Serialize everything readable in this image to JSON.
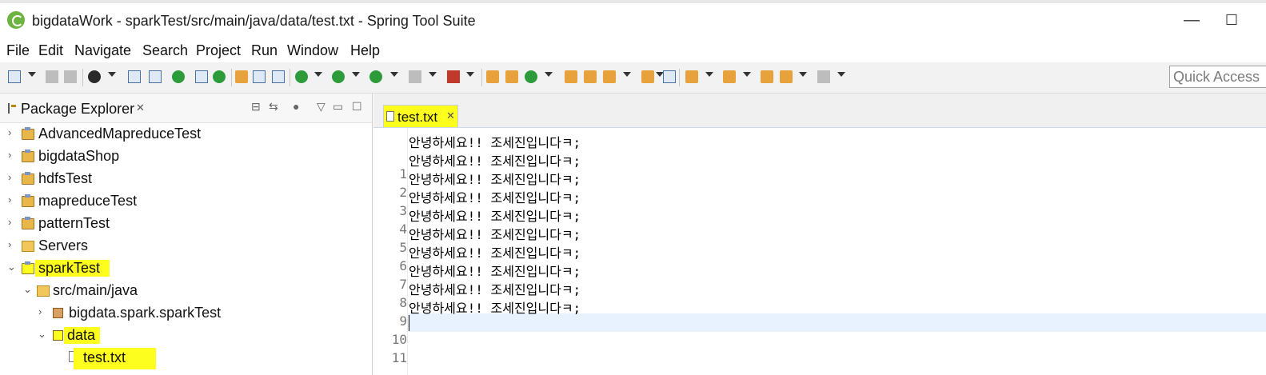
{
  "window": {
    "title": "bigdataWork - sparkTest/src/main/java/data/test.txt - Spring Tool Suite",
    "min_glyph": "—",
    "max_glyph": "☐"
  },
  "menu": [
    "File",
    "Edit",
    "Navigate",
    "Search",
    "Project",
    "Run",
    "Window",
    "Help"
  ],
  "toolbar": {
    "quick_access_placeholder": "Quick Access",
    "icons": [
      "new-icon",
      "save-icon",
      "save-all-icon",
      "debug-icon",
      "run-icon",
      "external-tools-icon",
      "stop-icon",
      "search-icon",
      "back-icon",
      "forward-icon"
    ]
  },
  "explorer": {
    "tab_label": "Package Explorer",
    "close_glyph": "✕",
    "tree": [
      {
        "label": "AdvancedMapreduceTest",
        "icon": "project",
        "expanded": false
      },
      {
        "label": "bigdataShop",
        "icon": "project",
        "expanded": false
      },
      {
        "label": "hdfsTest",
        "icon": "project",
        "expanded": false
      },
      {
        "label": "mapreduceTest",
        "icon": "project",
        "expanded": false
      },
      {
        "label": "patternTest",
        "icon": "project",
        "expanded": false
      },
      {
        "label": "Servers",
        "icon": "folder",
        "expanded": false
      },
      {
        "label": "sparkTest",
        "icon": "project",
        "expanded": true,
        "highlighted": true
      },
      {
        "label": "src/main/java",
        "icon": "source-folder",
        "expanded": true
      },
      {
        "label": "bigdata.spark.sparkTest",
        "icon": "package",
        "expanded": false
      },
      {
        "label": "data",
        "icon": "package",
        "expanded": true,
        "highlighted": true
      },
      {
        "label": "test.txt",
        "icon": "file",
        "selected": true,
        "highlighted": true
      }
    ]
  },
  "editor": {
    "tab_label": "test.txt",
    "close_glyph": "✕",
    "lines": [
      "안녕하세요!! 조세진입니다ㅋ;",
      "안녕하세요!! 조세진입니다ㅋ;",
      "안녕하세요!! 조세진입니다ㅋ;",
      "안녕하세요!! 조세진입니다ㅋ;",
      "안녕하세요!! 조세진입니다ㅋ;",
      "안녕하세요!! 조세진입니다ㅋ;",
      "안녕하세요!! 조세진입니다ㅋ;",
      "안녕하세요!! 조세진입니다ㅋ;",
      "안녕하세요!! 조세진입니다ㅋ;",
      "안녕하세요!! 조세진입니다ㅋ;",
      ""
    ],
    "line_numbers": [
      "1",
      "2",
      "3",
      "4",
      "5",
      "6",
      "7",
      "8",
      "9",
      "10",
      "11"
    ],
    "current_line": 11
  },
  "colors": {
    "highlight": "#fefe1e",
    "current_line_bg": "#e8f2fe",
    "toolbar_bg": "#f2f2f2"
  }
}
